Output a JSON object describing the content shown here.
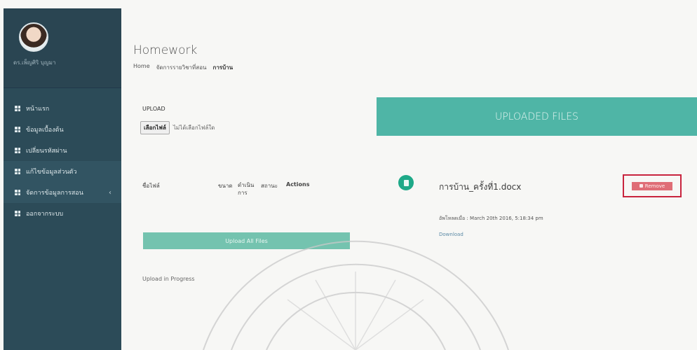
{
  "sidebar": {
    "profile_name": "ดร.เพ็ญศิริ บุญมา",
    "items": [
      {
        "label": "หน้าแรก"
      },
      {
        "label": "ข้อมูลเบื้องต้น"
      },
      {
        "label": "เปลี่ยนรหัสผ่าน"
      },
      {
        "label": "แก้ไขข้อมูลส่วนตัว"
      },
      {
        "label": "จัดการข้อมูลการสอน"
      },
      {
        "label": "ออกจากระบบ"
      }
    ],
    "caret": "‹"
  },
  "header": {
    "title": "Homework",
    "breadcrumb": [
      "Home",
      "จัดการรายวิชาที่สอน",
      "การบ้าน"
    ]
  },
  "upload": {
    "label": "UPLOAD",
    "choose_button": "เลือกไฟล์",
    "choose_status": "ไม่ได้เลือกไฟล์ใด",
    "columns": [
      "ชื่อไฟล์",
      "ขนาด",
      "ดำเนินการ",
      "สถานะ",
      "Actions"
    ],
    "upload_all_label": "Upload All Files",
    "progress_label": "Upload in Progress"
  },
  "uploaded": {
    "header": "UPLOADED FILES",
    "file_name": "การบ้าน_ครั้งที่1.docx",
    "remove_label": "Remove",
    "meta": "อัพโหลดเมื่อ : March 20th 2016, 5:18:34 pm",
    "download_label": "Download"
  },
  "colors": {
    "sidebar_bg": "#2c4b58",
    "accent_teal": "#4fb5a6",
    "remove_red": "#df6d76",
    "highlight_box": "#c8243e"
  },
  "icons": [
    "grid-icon",
    "file-icon",
    "lock-icon",
    "chevron-left-icon"
  ]
}
